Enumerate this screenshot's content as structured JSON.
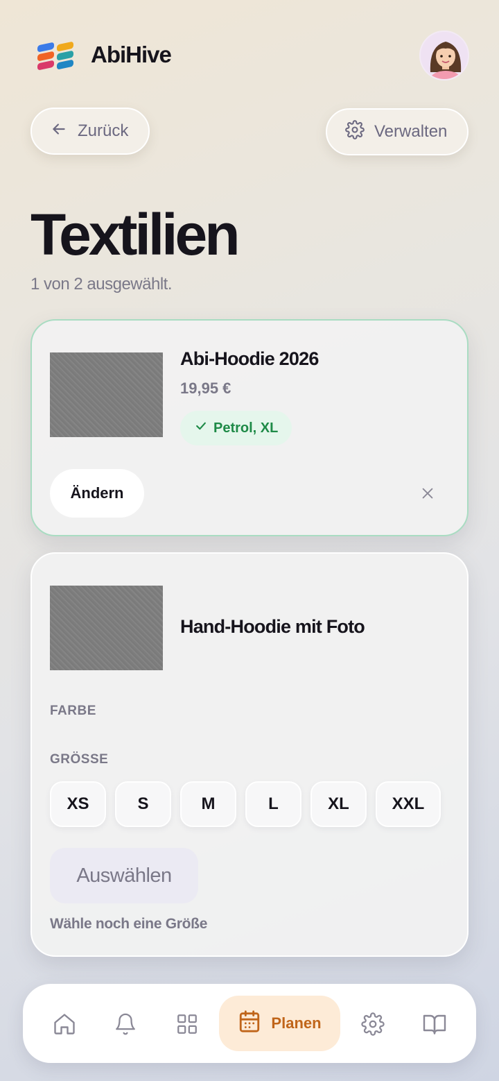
{
  "app": {
    "name": "AbiHive"
  },
  "header": {
    "back_label": "Zurück",
    "manage_label": "Verwalten"
  },
  "page": {
    "title": "Textilien",
    "subtitle": "1 von 2 ausgewählt."
  },
  "products": [
    {
      "name": "Abi-Hoodie 2026",
      "price": "19,95 €",
      "selection": "Petrol, XL",
      "change_label": "Ändern"
    },
    {
      "name": "Hand-Hoodie mit Foto",
      "color_label": "FARBE",
      "size_label": "GRÖSSE",
      "sizes": [
        "XS",
        "S",
        "M",
        "L",
        "XL",
        "XXL"
      ],
      "select_label": "Auswählen",
      "hint": "Wähle noch eine Größe"
    }
  ],
  "nav": {
    "items": [
      "home-icon",
      "bell-icon",
      "grid-icon",
      "calendar-icon",
      "gear-icon",
      "book-icon"
    ],
    "active_label": "Planen"
  },
  "colors": {
    "accent": "#c0651a",
    "success": "#1e8a47",
    "card_border": "#a9dcc2"
  }
}
